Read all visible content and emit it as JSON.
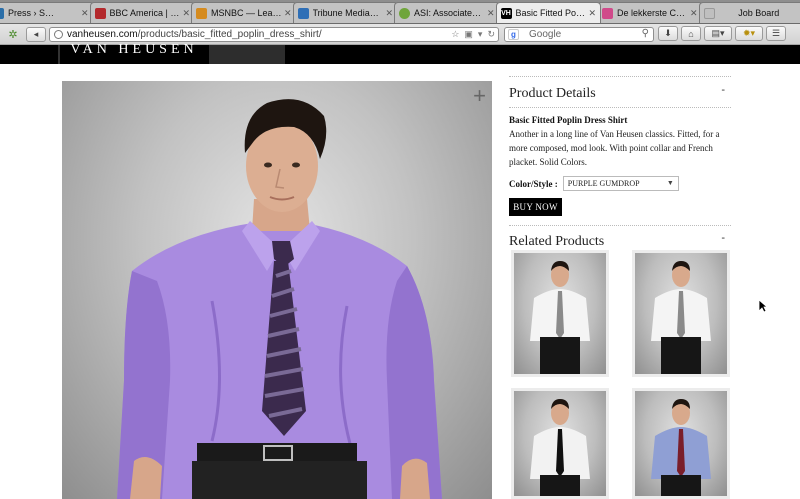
{
  "browser": {
    "tabs": [
      {
        "label": "Press › S…",
        "favicon_color": "#2a6ea8",
        "active": false
      },
      {
        "label": "BBC America | …",
        "favicon_color": "#b3292c",
        "active": false
      },
      {
        "label": "MSNBC — Lea…",
        "favicon_color": "#d58b1f",
        "active": false
      },
      {
        "label": "Tribune Media…",
        "favicon_color": "#2f6fb6",
        "active": false
      },
      {
        "label": "ASI: Associate…",
        "favicon_color": "#6fa53a",
        "active": false
      },
      {
        "label": "Basic Fitted Po…",
        "favicon_color": "#000000",
        "favicon_text": "VH",
        "active": true
      },
      {
        "label": "De lekkerste C…",
        "favicon_color": "#d04a8a",
        "active": false
      },
      {
        "label": "Job Board",
        "favicon_color": "#bfbfbf",
        "active": false
      }
    ],
    "url_domain": "vanheusen.com",
    "url_path": "/products/basic_fitted_poplin_dress_shirt/",
    "search_placeholder": "Google",
    "search_engine_glyph": "g"
  },
  "site": {
    "logo": "VAN HEUSEN"
  },
  "product_image": {
    "zoom_symbol": "+",
    "shirt_color": "#a98be0",
    "alt": "Model in purple dress shirt and striped tie"
  },
  "product_details": {
    "title": "Product Details",
    "toggle": "-",
    "name": "Basic Fitted Poplin Dress Shirt",
    "description": "Another in a long line of Van Heusen classics. Fitted, for a more composed, mod look. With point collar and French placket. Solid Colors.",
    "color_label": "Color/Style :",
    "color_value": "PURPLE GUMDROP",
    "buy_label": "BUY NOW"
  },
  "related_products": {
    "title": "Related Products",
    "toggle": "-",
    "items": [
      {
        "shirt_color": "#f4f4f4",
        "tie_color": "#8a8a8a"
      },
      {
        "shirt_color": "#f4f4f4",
        "tie_color": "#8a8a8a"
      },
      {
        "shirt_color": "#f2f2f2",
        "tie_color": "#111111"
      },
      {
        "shirt_color": "#8f9fd4",
        "tie_color": "#7a1e2a"
      }
    ]
  },
  "colors": {
    "accent_black": "#000000",
    "page_background": "#ffffff"
  }
}
